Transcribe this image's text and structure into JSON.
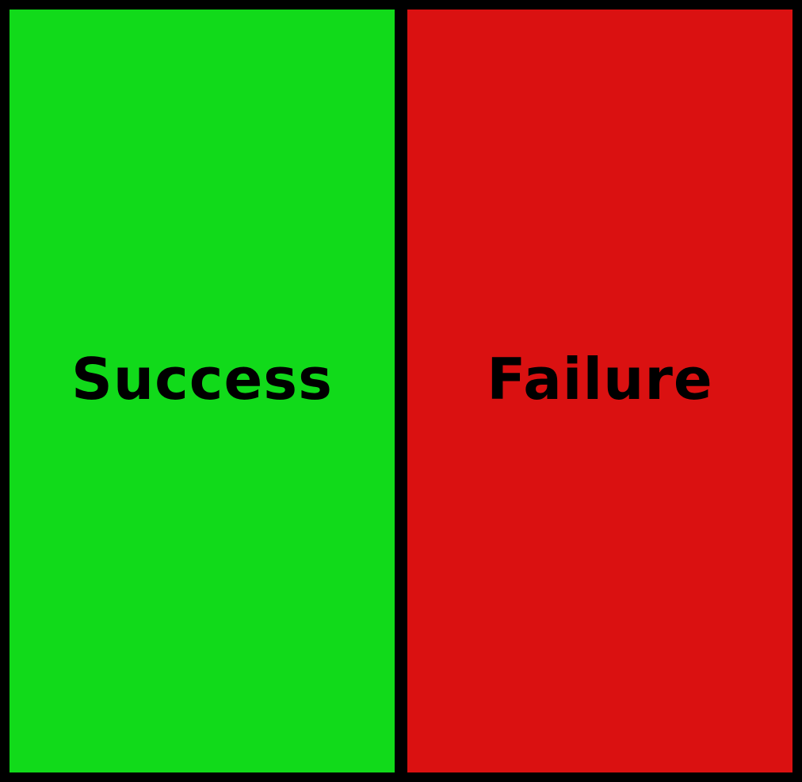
{
  "panels": [
    {
      "label": "Success",
      "color": "#11DA1A"
    },
    {
      "label": "Failure",
      "color": "#DA1111"
    }
  ],
  "border_color": "#000000"
}
